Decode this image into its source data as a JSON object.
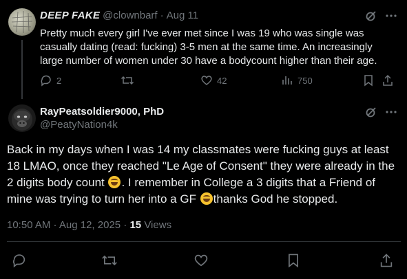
{
  "tweet1": {
    "display_name": "DEEP FAKE",
    "handle": "@clownbarf",
    "dot": "·",
    "date": "Aug 11",
    "text": "Pretty much every girl I've ever met since I was 19 who was single was casually dating (read: fucking) 3-5 men at the same time. An increasingly large number of women under 30 have a bodycount higher than their age.",
    "replies": "2",
    "likes": "42",
    "views": "750"
  },
  "tweet2": {
    "display_name": "RayPeatsoldier9000, PhD",
    "handle": "@PeatyNation4k",
    "text_part1": "Back in my days when I was 14 my classmates were fucking guys at least 18 LMAO, once they reached \"Le Age of Consent\" they were already in the 2 digits body count ",
    "text_part2": ". I remember in College a 3 digits that a Friend of mine was trying to turn her into a GF ",
    "text_part3": "thanks God he stopped.",
    "time": "10:50 AM · Aug 12, 2025 ·",
    "views_count": "15",
    "views_label": "Views"
  }
}
